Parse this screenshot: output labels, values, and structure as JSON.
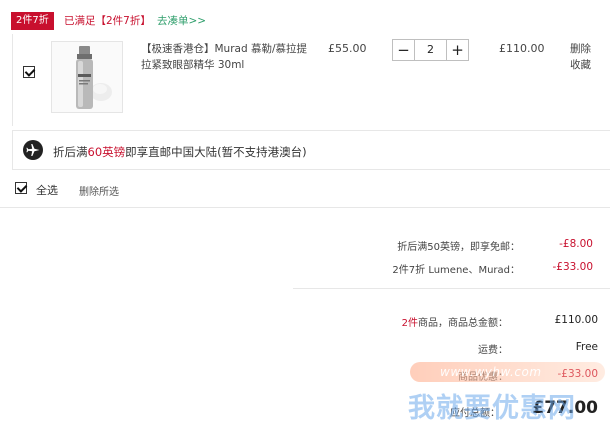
{
  "promo": {
    "tag": "2件7折",
    "status": "已满足【2件7折】",
    "link": "去凑单>>"
  },
  "item": {
    "name": "【极速香港仓】Murad 慕勒/慕拉提拉紧致眼部精华 30ml",
    "unit_price": "£55.00",
    "quantity": "2",
    "minus": "−",
    "plus": "+",
    "line_total": "£110.00",
    "delete": "删除",
    "favorite": "收藏",
    "checked": true
  },
  "shipping": {
    "prefix": "折后满",
    "highlight": "60英镑",
    "suffix": "即享直邮中国大陆(暂不支持港澳台)"
  },
  "select_all": {
    "label": "全选",
    "delete_selected": "删除所选",
    "checked": true
  },
  "discounts": [
    {
      "label": "折后满50英镑，即享免邮：",
      "value": "-£8.00"
    },
    {
      "label": "2件7折 Lumene、Murad：",
      "value": "-£33.00"
    }
  ],
  "summary": {
    "count_prefix": "2件",
    "goods_label": "商品，商品总金额：",
    "goods_value": "£110.00",
    "shipping_label": "运费：",
    "shipping_value": "Free",
    "discount_label": "商品优惠：",
    "discount_value": "-£33.00",
    "total_label": "应付总额：",
    "total_value": "£77.00"
  },
  "watermark": {
    "url": "www.wyhw.com",
    "text": "我就要优惠网"
  },
  "colors": {
    "accent_red": "#c8102e",
    "link_green": "#2e9e6b"
  }
}
